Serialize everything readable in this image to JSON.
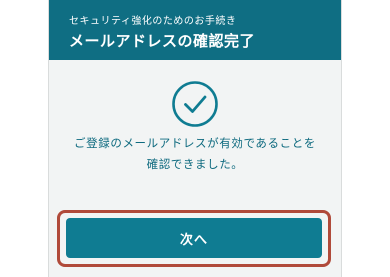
{
  "header": {
    "subtitle": "セキュリティ強化のためのお手続き",
    "title": "メールアドレスの確認完了"
  },
  "status_icon": "check-circle-icon",
  "message": {
    "line1": "ご登録のメールアドレスが有効であることを",
    "line2": "確認できました。"
  },
  "actions": {
    "next_label": "次へ"
  },
  "colors": {
    "header_bg": "#0f6e83",
    "accent": "#0f7c92",
    "highlight_border": "#b04a3a",
    "text": "#0e6a7f"
  }
}
